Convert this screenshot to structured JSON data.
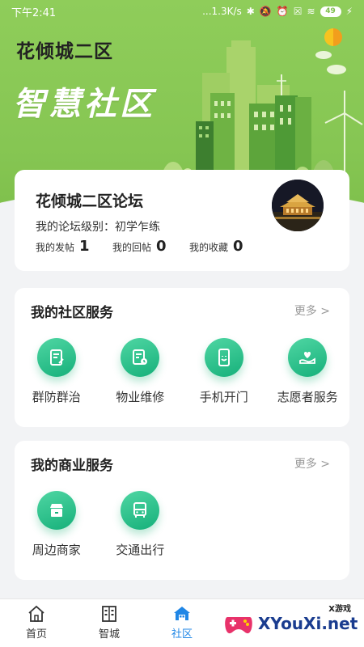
{
  "status_bar": {
    "time": "下午2:41",
    "network_speed": "...1.3K/s",
    "battery_level": "49"
  },
  "header": {
    "community_name": "花倾城二区",
    "banner_title": "智慧社区"
  },
  "forum": {
    "title": "花倾城二区论坛",
    "level_text": "我的论坛级别：初学乍练",
    "stats": [
      {
        "label": "我的发帖",
        "value": "1"
      },
      {
        "label": "我的回帖",
        "value": "0"
      },
      {
        "label": "我的收藏",
        "value": "0"
      }
    ]
  },
  "community_services": {
    "title": "我的社区服务",
    "more": "更多 >",
    "items": [
      {
        "label": "群防群治",
        "icon": "document-edit-icon"
      },
      {
        "label": "物业维修",
        "icon": "document-clock-icon"
      },
      {
        "label": "手机开门",
        "icon": "phone-door-icon"
      },
      {
        "label": "志愿者服务",
        "icon": "heart-hand-icon"
      }
    ]
  },
  "business_services": {
    "title": "我的商业服务",
    "more": "更多 >",
    "items": [
      {
        "label": "周边商家",
        "icon": "store-icon"
      },
      {
        "label": "交通出行",
        "icon": "bus-icon"
      }
    ]
  },
  "bottom_nav": {
    "items": [
      {
        "label": "首页",
        "icon": "home-outline-icon"
      },
      {
        "label": "智城",
        "icon": "building-icon"
      },
      {
        "label": "社区",
        "icon": "community-home-icon",
        "active": true
      }
    ]
  },
  "watermark": {
    "text": "XYouXi.net",
    "small": "X游戏"
  },
  "colors": {
    "banner_green": "#86c653",
    "service_icon": "#16b07a",
    "nav_active": "#1f86e6"
  }
}
